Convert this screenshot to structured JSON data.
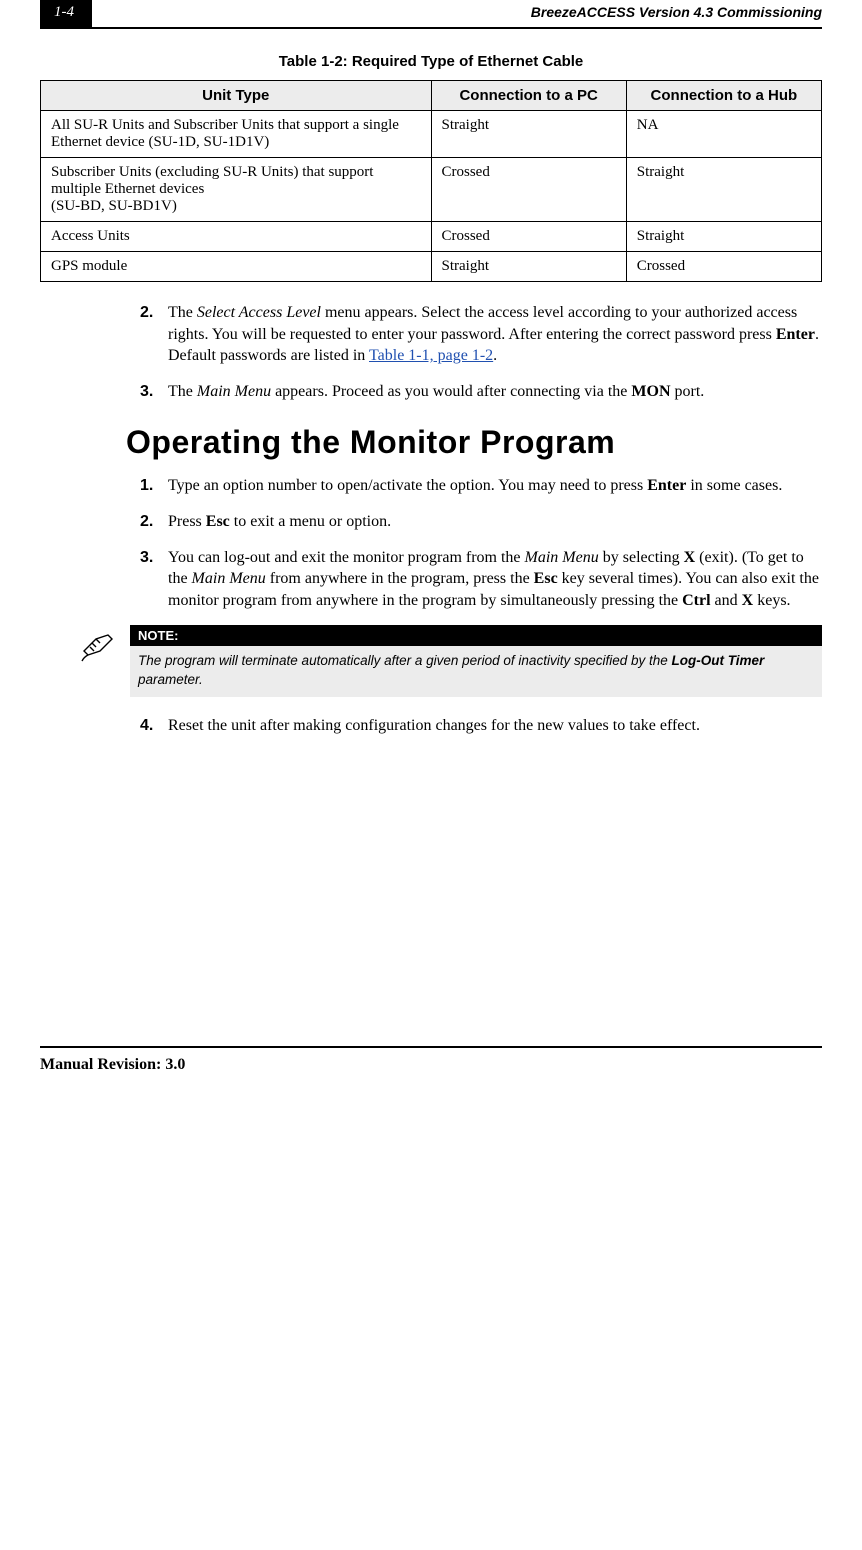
{
  "header": {
    "page_num": "1-4",
    "doc_title": "BreezeACCESS Version 4.3 Commissioning"
  },
  "table": {
    "caption": "Table 1-2: Required Type of Ethernet Cable",
    "headers": [
      "Unit Type",
      "Connection to a PC",
      "Connection to a Hub"
    ],
    "rows": [
      {
        "unit": "All SU-R Units and Subscriber Units that support a single Ethernet device (SU-1D, SU-1D1V)",
        "pc": "Straight",
        "hub": "NA"
      },
      {
        "unit": "Subscriber Units  (excluding SU-R Units) that support multiple Ethernet devices\n(SU-BD, SU-BD1V)",
        "pc": "Crossed",
        "hub": "Straight"
      },
      {
        "unit": "Access Units",
        "pc": "Crossed",
        "hub": "Straight"
      },
      {
        "unit": "GPS module",
        "pc": "Straight",
        "hub": "Crossed"
      }
    ]
  },
  "steps_a": {
    "two": {
      "num": "2.",
      "t1": "The ",
      "i1": "Select Access Level",
      "t2": " menu appears. Select the access level according to your authorized access rights. You will be requested to enter your password. After entering the correct password press ",
      "b1": "Enter",
      "t3": ". Default passwords are listed in ",
      "link": "Table 1-1, page 1-2",
      "t4": "."
    },
    "three": {
      "num": "3.",
      "t1": "The ",
      "i1": "Main Menu",
      "t2": " appears. Proceed as you would after connecting via the ",
      "b1": "MON",
      "t3": " port."
    }
  },
  "section_title": "Operating the Monitor Program",
  "steps_b": {
    "one": {
      "num": "1.",
      "t1": "Type an option number to open/activate the option. You may need to press ",
      "b1": "Enter",
      "t2": " in some cases."
    },
    "two": {
      "num": "2.",
      "t1": "Press ",
      "b1": "Esc",
      "t2": " to exit a menu or option."
    },
    "three": {
      "num": "3.",
      "t1": "You can log-out and exit the monitor program from the ",
      "i1": "Main Menu",
      "t2": " by selecting ",
      "b1": "X",
      "t3": " (exit). (To get to the ",
      "i2": "Main Menu",
      "t4": " from anywhere in the program, press the ",
      "b2": "Esc",
      "t5": " key several times). You can also exit the monitor program from anywhere in the program by simultaneously pressing the ",
      "b3": "Ctrl",
      "t6": " and ",
      "b4": "X",
      "t7": " keys."
    },
    "four": {
      "num": "4.",
      "t1": "Reset the unit after making configuration changes for the new values to take effect."
    }
  },
  "note": {
    "label": "NOTE:",
    "t1": "The program will terminate automatically after a given period of inactivity specified by the ",
    "bi": "Log-Out Timer",
    "t2": " parameter."
  },
  "footer": "Manual Revision: 3.0"
}
